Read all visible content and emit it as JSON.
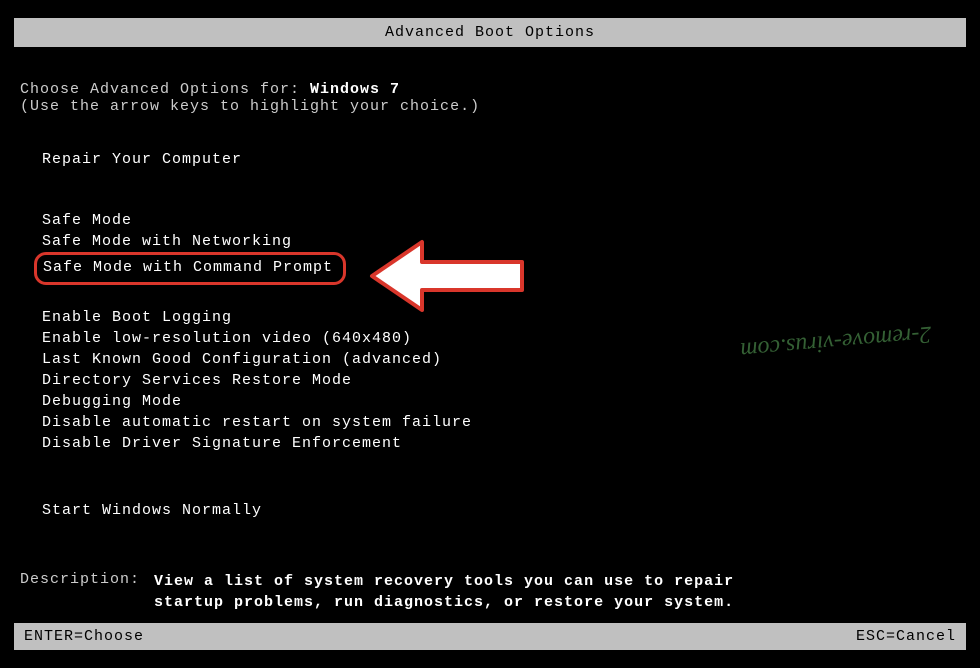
{
  "header": {
    "title": "Advanced Boot Options"
  },
  "choose": {
    "prefix": "Choose Advanced Options for: ",
    "os": "Windows 7",
    "hint": "(Use the arrow keys to highlight your choice.)"
  },
  "menu": {
    "repair": "Repair Your Computer",
    "safe_mode": "Safe Mode",
    "safe_mode_net": "Safe Mode with Networking",
    "safe_mode_cmd": "Safe Mode with Command Prompt",
    "boot_logging": "Enable Boot Logging",
    "lowres": "Enable low-resolution video (640x480)",
    "lkgc": "Last Known Good Configuration (advanced)",
    "dsrm": "Directory Services Restore Mode",
    "debug": "Debugging Mode",
    "no_auto_restart": "Disable automatic restart on system failure",
    "no_sig": "Disable Driver Signature Enforcement",
    "normal": "Start Windows Normally"
  },
  "description": {
    "label": "Description:",
    "line1": "View a list of system recovery tools you can use to repair",
    "line2": "startup problems, run diagnostics, or restore your system."
  },
  "footer": {
    "left": "ENTER=Choose",
    "right": "ESC=Cancel"
  },
  "watermark": "2-remove-virus.com",
  "colors": {
    "highlight_border": "#d9362b",
    "watermark": "#3a6b3a"
  }
}
